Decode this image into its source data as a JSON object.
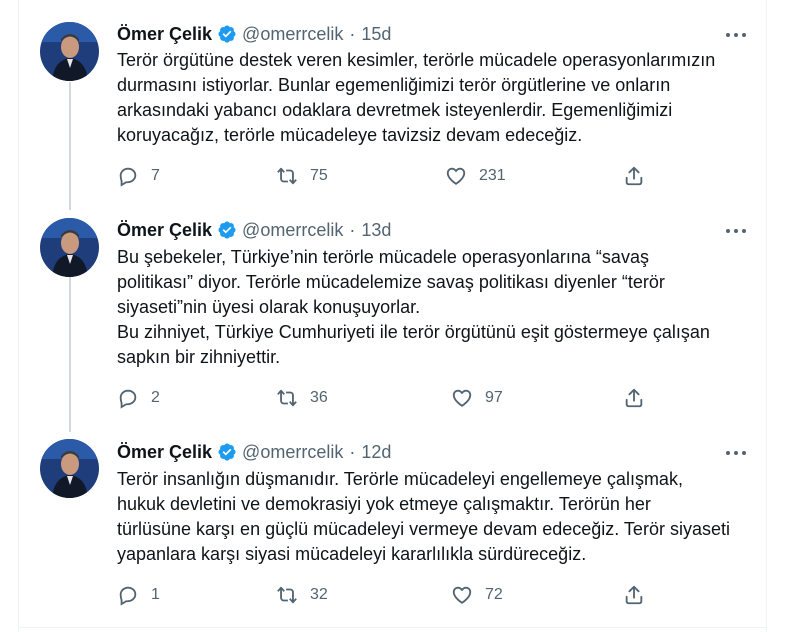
{
  "tweets": [
    {
      "name": "Ömer Çelik",
      "handle": "@omerrcelik",
      "separator": "·",
      "time": "15d",
      "lines": [
        "Terör örgütüne destek veren kesimler, terörle mücadele operasyonlarımızın",
        "durmasını istiyorlar. Bunlar egemenliğimizi terör örgütlerine ve onların",
        "arkasındaki yabancı odaklara devretmek isteyenlerdir. Egemenliğimizi",
        "koruyacağız, terörle mücadeleye tavizsiz devam edeceğiz."
      ],
      "replies": "7",
      "retweets": "75",
      "likes": "231"
    },
    {
      "name": "Ömer Çelik",
      "handle": "@omerrcelik",
      "separator": "·",
      "time": "13d",
      "lines": [
        "Bu şebekeler, Türkiye’nin terörle mücadele operasyonlarına “savaş",
        "politikası” diyor. Terörle mücadelemize savaş politikası diyenler “terör",
        "siyaseti”nin üyesi olarak konuşuyorlar.",
        "Bu zihniyet, Türkiye Cumhuriyeti ile terör örgütünü eşit göstermeye çalışan",
        "sapkın bir zihniyettir."
      ],
      "replies": "2",
      "retweets": "36",
      "likes": "97"
    },
    {
      "name": "Ömer Çelik",
      "handle": "@omerrcelik",
      "separator": "·",
      "time": "12d",
      "lines": [
        "Terör insanlığın düşmanıdır. Terörle mücadeleyi engellemeye çalışmak,",
        "hukuk devletini ve demokrasiyi yok etmeye çalışmaktır. Terörün her",
        "türlüsüne karşı en güçlü mücadeleyi vermeye devam edeceğiz. Terör siyaseti",
        "yapanlara karşı siyasi mücadeleyi kararlılıkla sürdüreceğiz."
      ],
      "replies": "1",
      "retweets": "32",
      "likes": "72"
    }
  ],
  "icons": {
    "verified": "verified-badge-icon",
    "more": "more-icon",
    "reply": "reply-icon",
    "retweet": "retweet-icon",
    "like": "like-icon",
    "share": "share-icon"
  },
  "colors": {
    "verified": "#1d9bf0",
    "secondary_text": "#536471",
    "thread_line": "#cfd9de"
  }
}
